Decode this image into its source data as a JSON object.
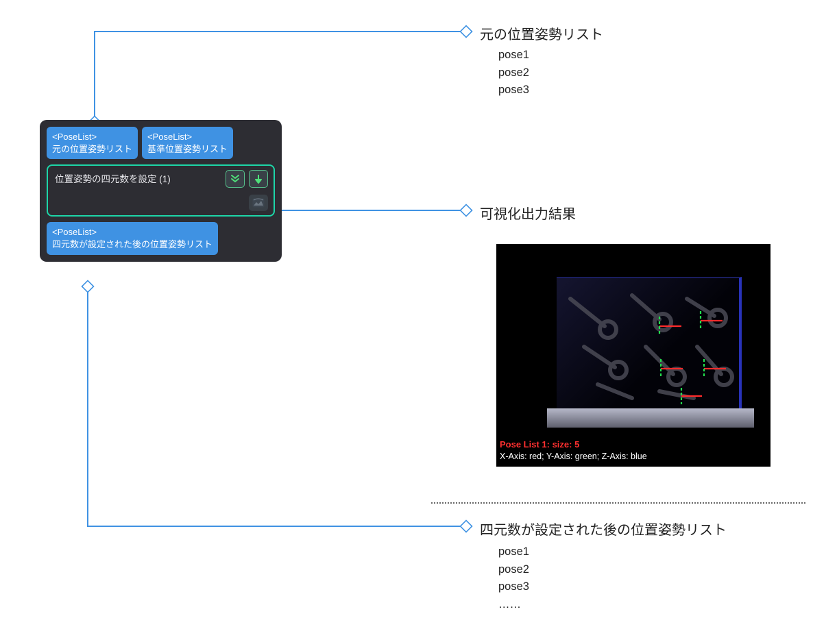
{
  "callouts": {
    "original": {
      "title": "元の位置姿勢リスト",
      "items": [
        "pose1",
        "pose2",
        "pose3"
      ]
    },
    "visual": {
      "title": "可視化出力結果"
    },
    "output": {
      "title": "四元数が設定された後の位置姿勢リスト",
      "items": [
        "pose1",
        "pose2",
        "pose3",
        "……"
      ]
    }
  },
  "node": {
    "inputs": [
      {
        "type": "<PoseList>",
        "label": "元の位置姿勢リスト"
      },
      {
        "type": "<PoseList>",
        "label": "基準位置姿勢リスト"
      }
    ],
    "center_title": "位置姿勢の四元数を設定 (1)",
    "output": {
      "type": "<PoseList>",
      "label": "四元数が設定された後の位置姿勢リスト"
    }
  },
  "viz": {
    "pose_info": "Pose List 1: size: 5",
    "axis_info": "X-Axis: red; Y-Axis: green; Z-Axis: blue"
  }
}
